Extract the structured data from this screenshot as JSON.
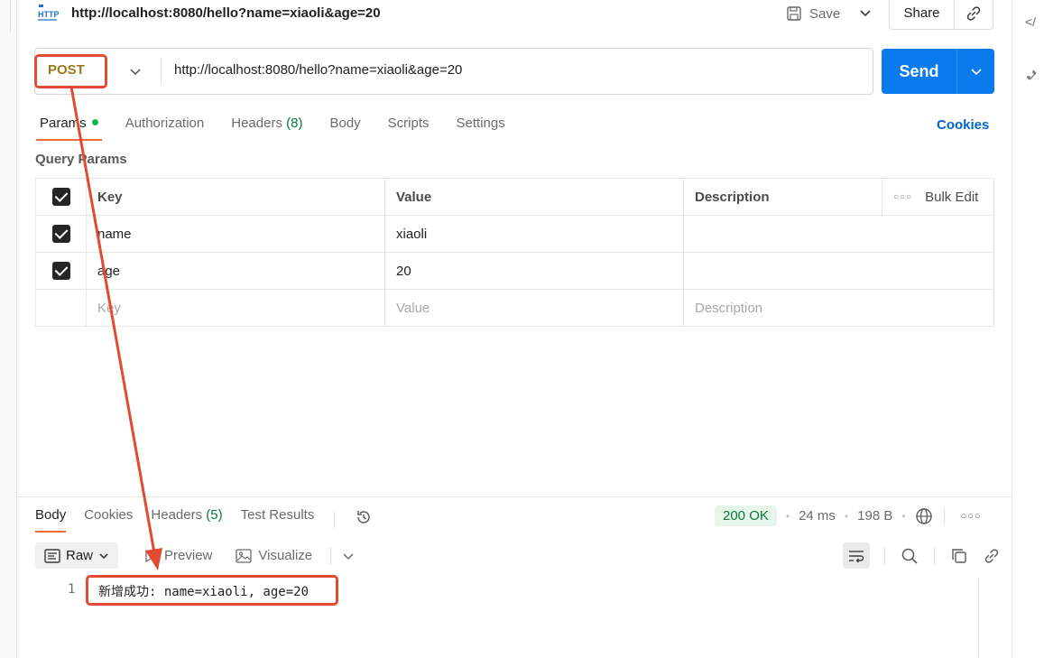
{
  "tab": {
    "title": "http://localhost:8080/hello?name=xiaoli&age=20",
    "icon_label": "HTTP"
  },
  "toolbar": {
    "save_label": "Save",
    "share_label": "Share"
  },
  "request": {
    "method": "POST",
    "url": "http://localhost:8080/hello?name=xiaoli&age=20",
    "send_label": "Send"
  },
  "req_tabs": {
    "params": "Params",
    "authorization": "Authorization",
    "headers": "Headers",
    "headers_count": "(8)",
    "body": "Body",
    "scripts": "Scripts",
    "settings": "Settings",
    "cookies": "Cookies"
  },
  "params": {
    "section_title": "Query Params",
    "headers": {
      "key": "Key",
      "value": "Value",
      "description": "Description",
      "bulk_edit": "Bulk Edit"
    },
    "rows": [
      {
        "key": "name",
        "value": "xiaoli",
        "description": ""
      },
      {
        "key": "age",
        "value": "20",
        "description": ""
      }
    ],
    "placeholders": {
      "key": "Key",
      "value": "Value",
      "description": "Description"
    }
  },
  "response": {
    "tabs": {
      "body": "Body",
      "cookies": "Cookies",
      "headers": "Headers",
      "headers_count": "(5)",
      "test_results": "Test Results"
    },
    "status": "200 OK",
    "time": "24 ms",
    "size": "198 B",
    "format": "Raw",
    "preview_label": "Preview",
    "visualize_label": "Visualize",
    "lines": [
      {
        "no": "1",
        "text": "新增成功: name=xiaoli, age=20"
      }
    ]
  },
  "colors": {
    "method": "#a0781b",
    "send": "#097bed",
    "accent": "#f26b3a",
    "status_ok": "#0a7a3a",
    "annotation": "#e24a33"
  }
}
